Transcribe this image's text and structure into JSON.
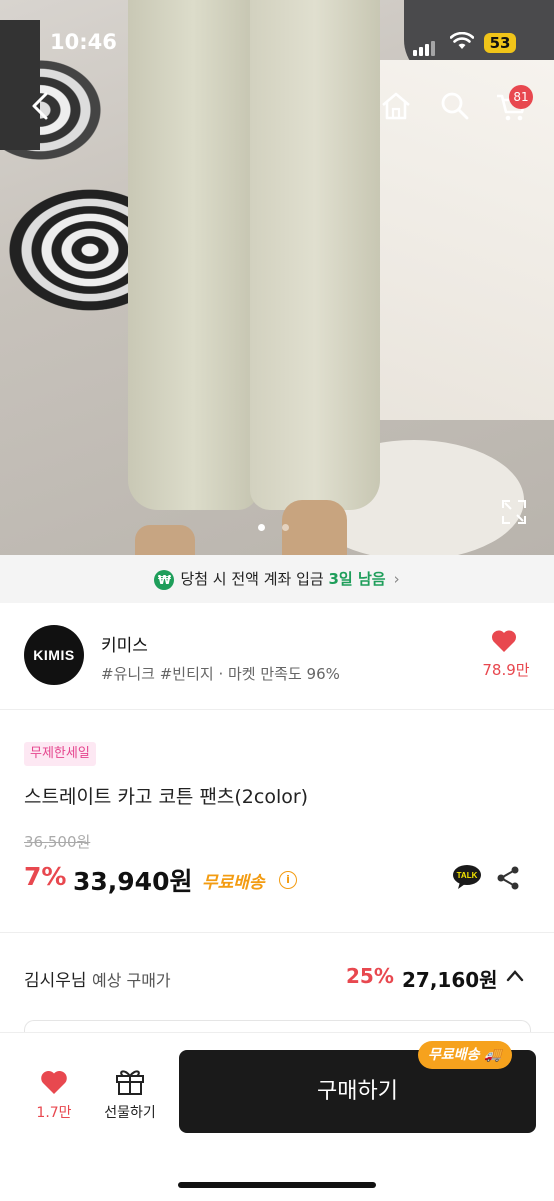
{
  "status_bar": {
    "time": "10:46",
    "battery": "53"
  },
  "header": {
    "cart_count": "81"
  },
  "gallery": {
    "current_page": 1,
    "total_pages": 2
  },
  "banner": {
    "text_before": "당첨 시 전액 계좌 입금",
    "highlight": "3일 남음"
  },
  "seller": {
    "logo_text": "KIMIS",
    "name": "키미스",
    "tags": "#유니크 #빈티지 · 마켓 만족도 96%",
    "likes": "78.9만"
  },
  "product": {
    "sale_badge": "무제한세일",
    "title": "스트레이트 카고 코튼 팬츠(2color)",
    "original_price": "36,500원",
    "discount_pct": "7%",
    "price": "33,940원",
    "shipping": "무료배송",
    "info_symbol": "i",
    "talk_label": "TALK"
  },
  "expected": {
    "user": "김시우님",
    "label": "예상 구매가",
    "discount_pct": "25%",
    "price": "27,160원"
  },
  "bottom_bar": {
    "like_count": "1.7만",
    "gift_label": "선물하기",
    "buy_label": "구매하기",
    "free_tag": "무료배송"
  },
  "colors": {
    "accent_red": "#e8484f",
    "accent_green": "#1e9e5a",
    "accent_orange": "#f39c12"
  }
}
